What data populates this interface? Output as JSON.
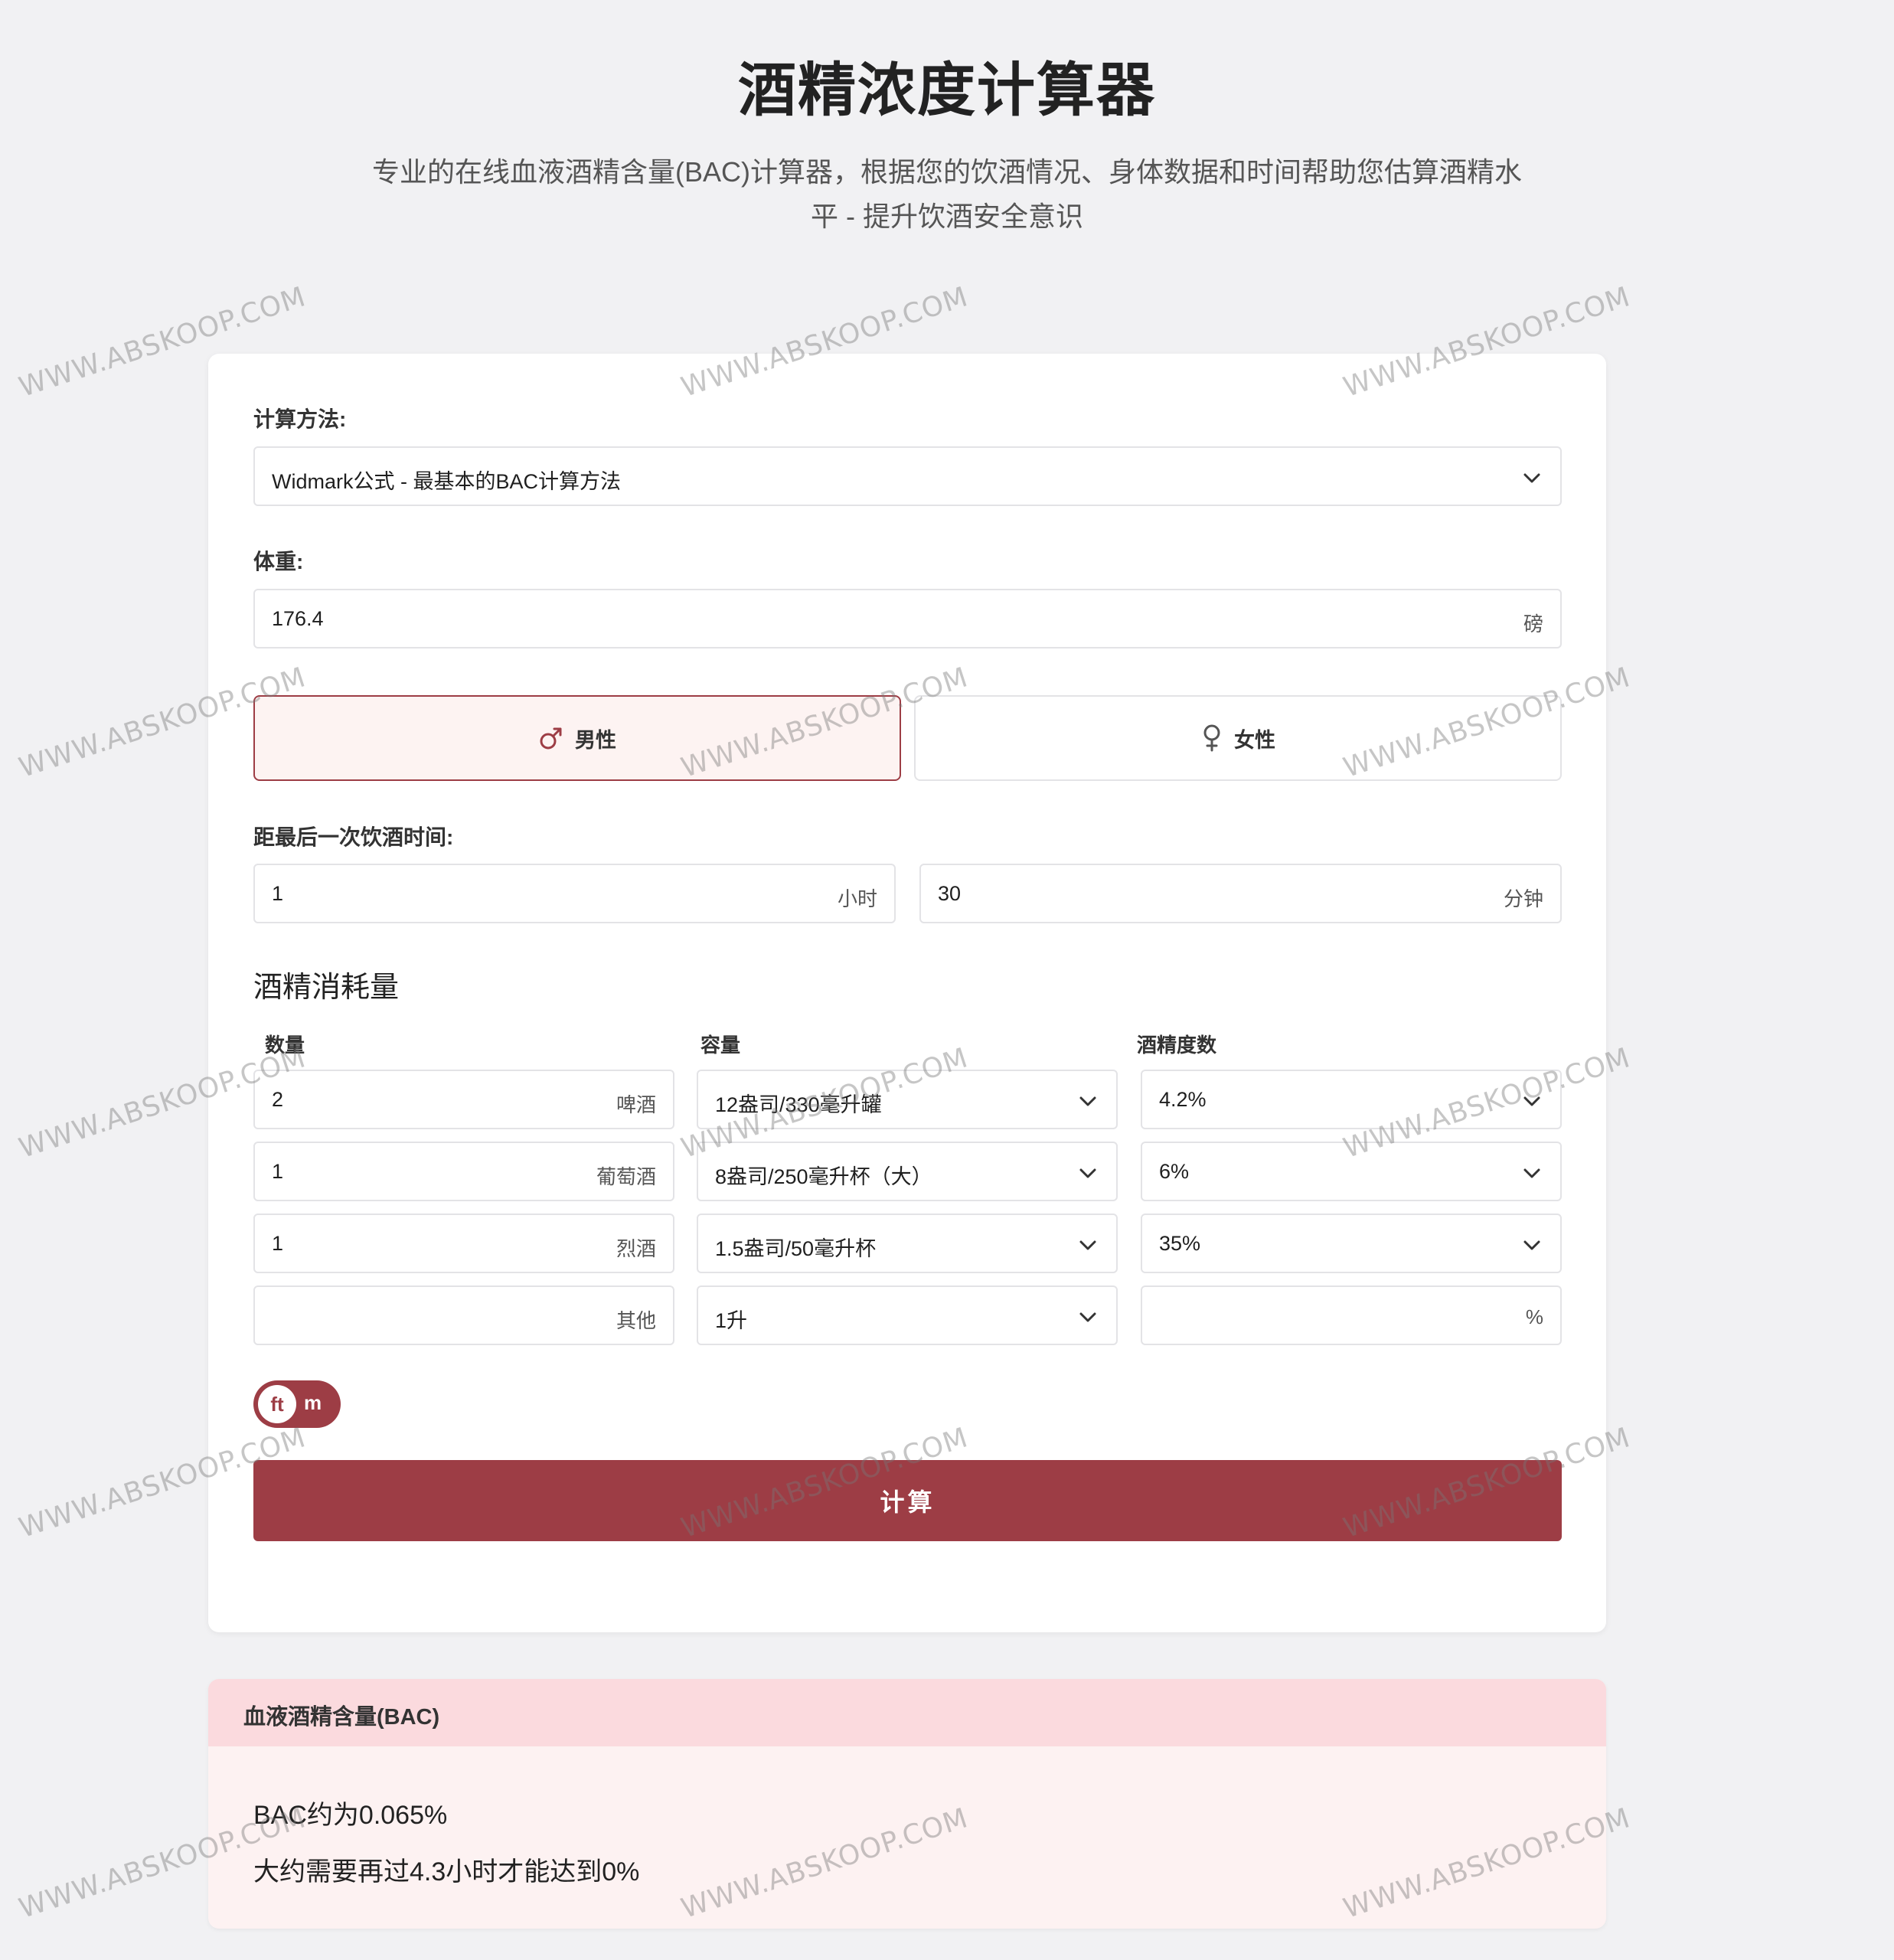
{
  "page": {
    "title": "酒精浓度计算器",
    "subtitle_line1": "专业的在线血液酒精含量(BAC)计算器，根据您的饮酒情况、身体数据和时间帮助您估算酒精水",
    "subtitle_line2": "平 - 提升饮酒安全意识"
  },
  "watermark": "WWW.ABSKOOP.COM",
  "form": {
    "method_label": "计算方法:",
    "method_value": "Widmark公式 - 最基本的BAC计算方法",
    "weight_label": "体重:",
    "weight_value": "176.4",
    "weight_unit": "磅",
    "gender": {
      "male": "男性",
      "female": "女性",
      "selected": "male"
    },
    "time_label": "距最后一次饮酒时间:",
    "hours_value": "1",
    "hours_unit": "小时",
    "minutes_value": "30",
    "minutes_unit": "分钟",
    "consumption_title": "酒精消耗量",
    "columns": [
      "数量",
      "容量",
      "酒精度数"
    ],
    "rows": [
      {
        "qty": "2",
        "type": "啤酒",
        "volume": "12盎司/330毫升罐",
        "abv": "4.2%"
      },
      {
        "qty": "1",
        "type": "葡萄酒",
        "volume": "8盎司/250毫升杯（大）",
        "abv": "6%"
      },
      {
        "qty": "1",
        "type": "烈酒",
        "volume": "1.5盎司/50毫升杯",
        "abv": "35%"
      },
      {
        "qty": "",
        "type": "其他",
        "volume": "1升",
        "abv": "",
        "abv_unit": "%"
      }
    ],
    "unit_toggle": {
      "active": "ft",
      "inactive": "m"
    },
    "calculate_label": "计算"
  },
  "result": {
    "header": "血液酒精含量(BAC)",
    "line1": "BAC约为0.065%",
    "line2": "大约需要再过4.3小时才能达到0%"
  },
  "colors": {
    "accent": "#9d3d45",
    "male_bg": "#fdf3f2",
    "result_header": "#fbdade",
    "result_bg": "#fdf2f2"
  }
}
